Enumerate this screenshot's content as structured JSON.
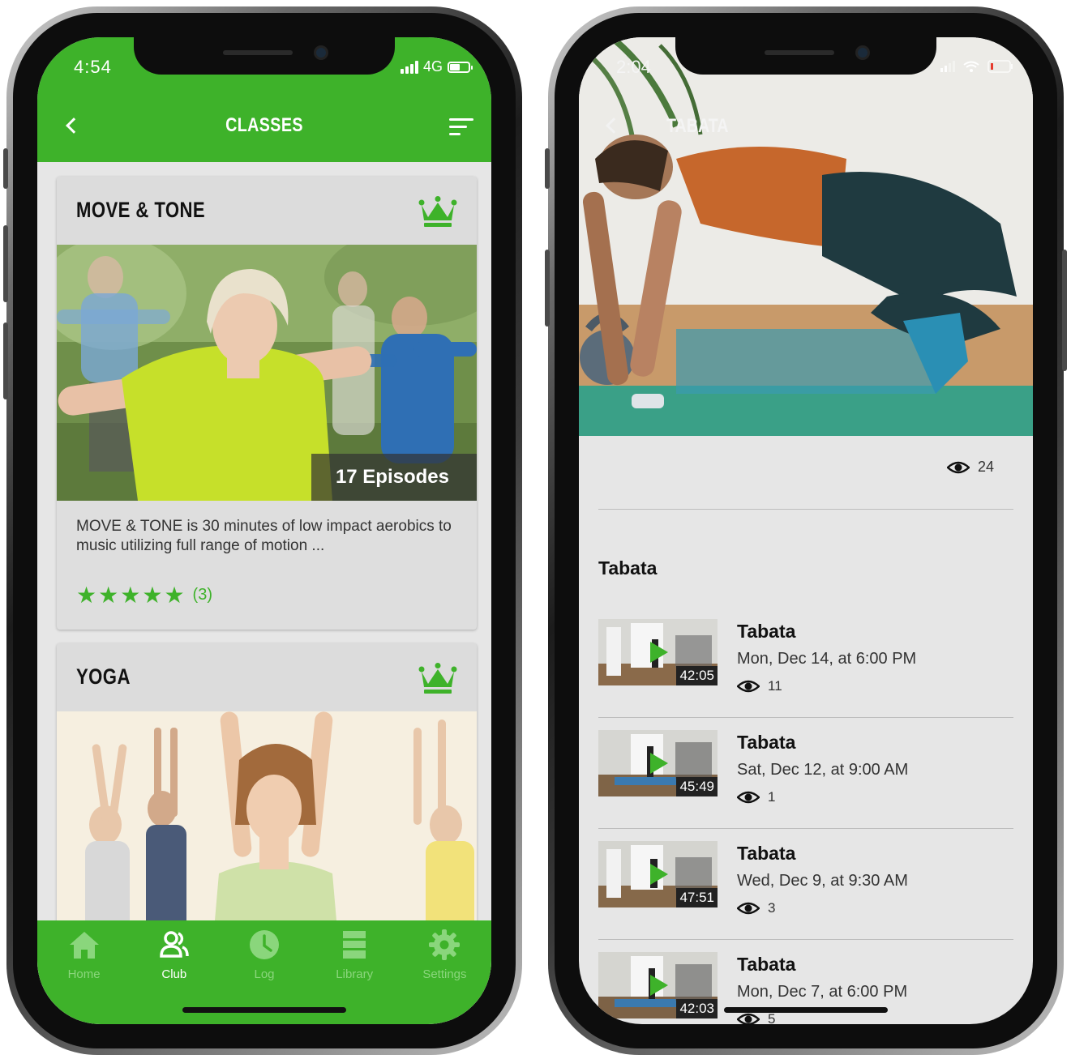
{
  "colors": {
    "accent": "#3eb22a",
    "background": "#e6e6e6"
  },
  "left_screen": {
    "status": {
      "time": "4:54",
      "network": "4G"
    },
    "header": {
      "title": "CLASSES"
    },
    "cards": [
      {
        "title": "MOVE & TONE",
        "episodes": "17 Episodes",
        "description": "MOVE & TONE is 30 minutes of low impact aerobics to music utilizing full range of motion ...",
        "rating_stars": 5,
        "rating_count": "(3)"
      },
      {
        "title": "YOGA"
      }
    ],
    "tabbar": [
      {
        "label": "Home",
        "icon": "home-icon"
      },
      {
        "label": "Club",
        "icon": "club-icon"
      },
      {
        "label": "Log",
        "icon": "clock-icon"
      },
      {
        "label": "Library",
        "icon": "library-icon"
      },
      {
        "label": "Settings",
        "icon": "gear-icon"
      }
    ],
    "active_tab": "Club"
  },
  "right_screen": {
    "status": {
      "time": "2:04"
    },
    "header": {
      "title": "TABATA"
    },
    "views": "24",
    "section_title": "Tabata",
    "episodes": [
      {
        "title": "Tabata",
        "date": "Mon, Dec 14, at 6:00 PM",
        "views": "11",
        "duration": "42:05"
      },
      {
        "title": "Tabata",
        "date": "Sat, Dec 12, at 9:00 AM",
        "views": "1",
        "duration": "45:49"
      },
      {
        "title": "Tabata",
        "date": "Wed, Dec 9, at 9:30 AM",
        "views": "3",
        "duration": "47:51"
      },
      {
        "title": "Tabata",
        "date": "Mon, Dec 7, at 6:00 PM",
        "views": "5",
        "duration": "42:03"
      }
    ]
  }
}
